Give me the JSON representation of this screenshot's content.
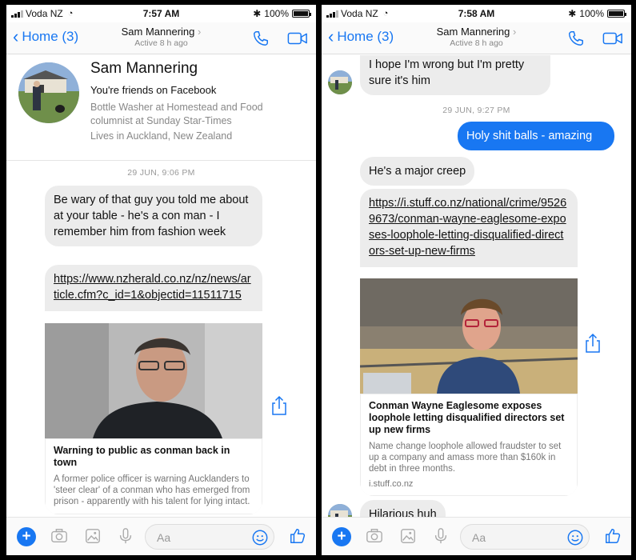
{
  "left": {
    "status": {
      "carrier": "Voda NZ",
      "time": "7:57 AM",
      "battery": "100%"
    },
    "nav": {
      "back_label": "Home (3)",
      "name": "Sam Mannering",
      "sub": "Active 8 h ago"
    },
    "profile": {
      "name": "Sam Mannering",
      "friends": "You're friends on Facebook",
      "job": "Bottle Washer at Homestead and Food columnist at Sunday Star-Times",
      "location": "Lives in Auckland, New Zealand"
    },
    "timestamp": "29 JUN, 9:06 PM",
    "msg1": "Be wary of that guy you told me about at your table - he's a con man - I remember him from fashion week",
    "link": "https://www.nzherald.co.nz/nz/news/article.cfm?c_id=1&objectid=11511715",
    "card": {
      "title": "Warning to public as conman back in town",
      "desc": "A former police officer is warning Aucklanders to 'steer clear' of a conman who has emerged from prison - apparently with his talent for lying intact."
    },
    "composer": {
      "placeholder": "Aa"
    }
  },
  "right": {
    "status": {
      "carrier": "Voda NZ",
      "time": "7:58 AM",
      "battery": "100%"
    },
    "nav": {
      "back_label": "Home (3)",
      "name": "Sam Mannering",
      "sub": "Active 8 h ago"
    },
    "msg_top": "I hope I'm wrong but I'm pretty sure it's him",
    "timestamp": "29 JUN, 9:27 PM",
    "msg_out": "Holy shit balls - amazing",
    "msg2": "He's a major creep",
    "link": "https://i.stuff.co.nz/national/crime/95269673/conman-wayne-eaglesome-exposes-loophole-letting-disqualified-directors-set-up-new-firms",
    "card": {
      "title": "Conman Wayne Eaglesome exposes loophole letting disqualified directors set up new firms",
      "desc": "Name change loophole allowed fraudster to set up a company and amass more than $160k in debt in three months.",
      "domain": "i.stuff.co.nz"
    },
    "msg3": "Hilarious huh",
    "composer": {
      "placeholder": "Aa"
    }
  },
  "colors": {
    "accent": "#1877f2",
    "bubble_in": "#ececec",
    "background": "#000000"
  },
  "icons": [
    "back-chevron",
    "phone-icon",
    "video-icon",
    "share-icon",
    "plus-icon",
    "camera-icon",
    "image-icon",
    "microphone-icon",
    "emoji-icon",
    "thumbs-up-icon"
  ]
}
